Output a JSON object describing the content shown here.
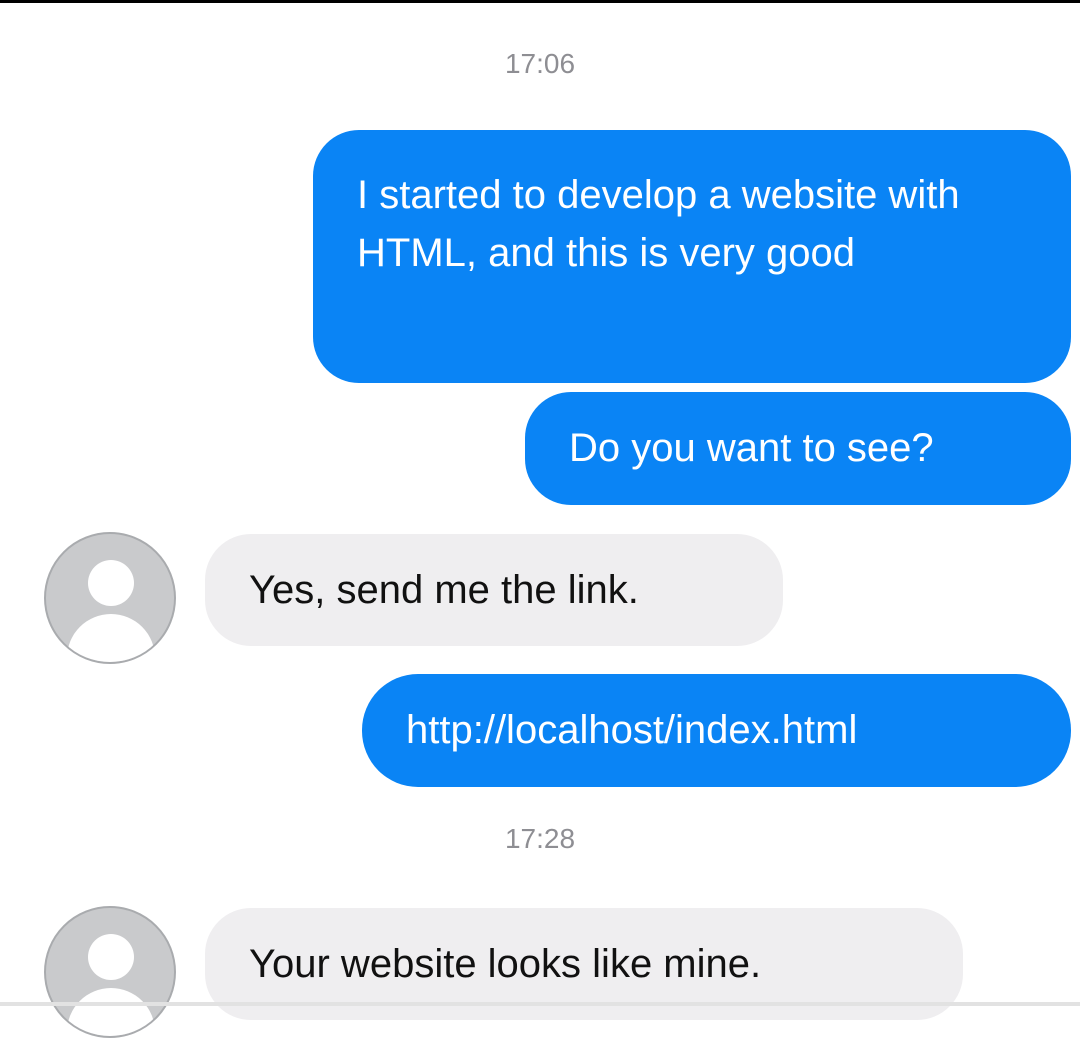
{
  "conversation": {
    "timestamps": [
      "17:06",
      "17:28"
    ],
    "messages": [
      {
        "direction": "outgoing",
        "text": "I started to develop a website with HTML, and this is very good"
      },
      {
        "direction": "outgoing",
        "text": "Do you want to see?"
      },
      {
        "direction": "incoming",
        "text": "Yes, send me the link."
      },
      {
        "direction": "outgoing",
        "text": "http://localhost/index.html"
      },
      {
        "direction": "incoming",
        "text": "Your website looks like mine."
      }
    ]
  },
  "colors": {
    "outgoing_bubble": "#0a84f5",
    "incoming_bubble": "#efeef0",
    "timestamp_text": "#8e8e93",
    "avatar": "#c9cacc"
  },
  "icons": {
    "avatar": "default-user-avatar-icon"
  }
}
